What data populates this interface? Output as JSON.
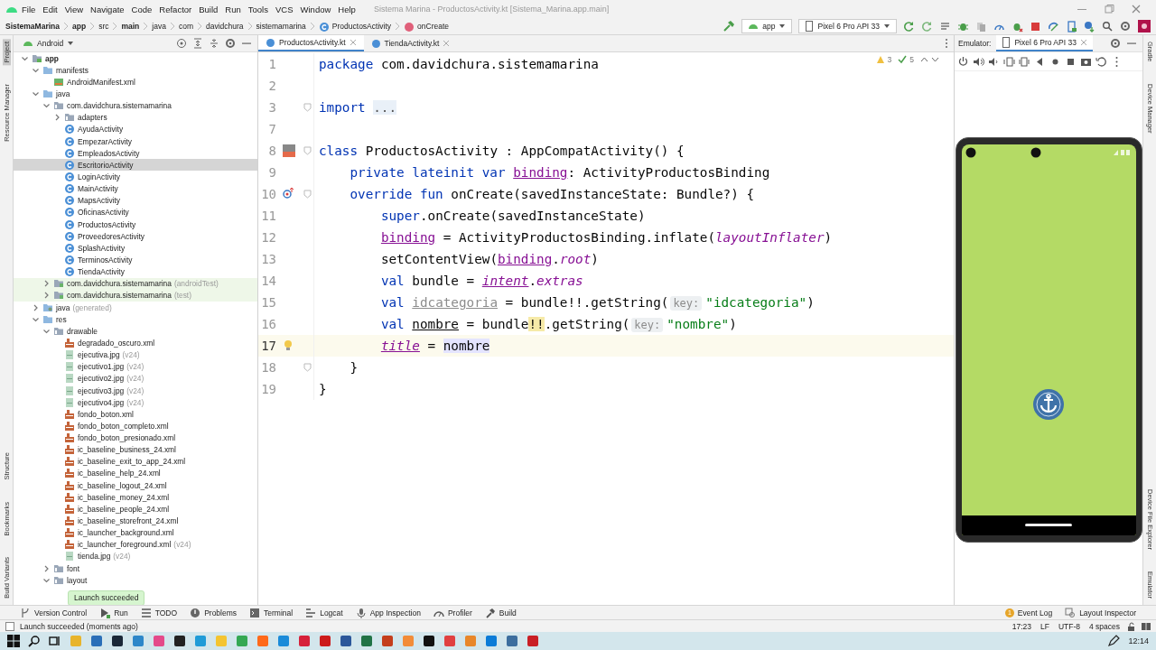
{
  "title_bar": {
    "menu": [
      "File",
      "Edit",
      "View",
      "Navigate",
      "Code",
      "Refactor",
      "Build",
      "Run",
      "Tools",
      "VCS",
      "Window",
      "Help"
    ],
    "title": "Sistema Marina - ProductosActivity.kt [Sistema_Marina.app.main]"
  },
  "breadcrumb": [
    {
      "label": "SistemaMarina",
      "kind": "bold"
    },
    {
      "label": "app",
      "kind": "bold"
    },
    {
      "label": "src",
      "kind": "plain"
    },
    {
      "label": "main",
      "kind": "bold"
    },
    {
      "label": "java",
      "kind": "plain"
    },
    {
      "label": "com",
      "kind": "plain"
    },
    {
      "label": "davidchura",
      "kind": "plain"
    },
    {
      "label": "sistemamarina",
      "kind": "plain"
    },
    {
      "label": "ProductosActivity",
      "kind": "class"
    },
    {
      "label": "onCreate",
      "kind": "method"
    }
  ],
  "toolbar": {
    "config": "app",
    "device": "Pixel 6 Pro API 33"
  },
  "left_tool_tabs": [
    {
      "label": "Project",
      "selected": true,
      "kind": "top"
    },
    {
      "label": "Resource Manager",
      "selected": false,
      "kind": "top"
    },
    {
      "label": "Structure",
      "selected": false,
      "kind": "bottom"
    },
    {
      "label": "Bookmarks",
      "selected": false,
      "kind": "bottom"
    },
    {
      "label": "Build Variants",
      "selected": false,
      "kind": "bottom"
    }
  ],
  "project": {
    "view": "Android",
    "tree": [
      {
        "label": "app",
        "kind": "module",
        "expanded": true,
        "selected": false,
        "children": [
          {
            "label": "manifests",
            "kind": "folder",
            "expanded": true,
            "selected": false,
            "children": [
              {
                "label": "AndroidManifest.xml",
                "kind": "manifest",
                "selected": false
              }
            ]
          },
          {
            "label": "java",
            "kind": "folder",
            "expanded": true,
            "selected": false,
            "children": [
              {
                "label": "com.davidchura.sistemamarina",
                "kind": "package",
                "expanded": true,
                "selected": false,
                "children": [
                  {
                    "label": "adapters",
                    "kind": "package",
                    "expanded": false,
                    "selected": false
                  },
                  {
                    "label": "AyudaActivity",
                    "kind": "class",
                    "selected": false
                  },
                  {
                    "label": "EmpezarActivity",
                    "kind": "class",
                    "selected": false
                  },
                  {
                    "label": "EmpleadosActivity",
                    "kind": "class",
                    "selected": false
                  },
                  {
                    "label": "EscritorioActivity",
                    "kind": "class",
                    "selected": true
                  },
                  {
                    "label": "LoginActivity",
                    "kind": "class",
                    "selected": false
                  },
                  {
                    "label": "MainActivity",
                    "kind": "class",
                    "selected": false
                  },
                  {
                    "label": "MapsActivity",
                    "kind": "class",
                    "selected": false
                  },
                  {
                    "label": "OficinasActivity",
                    "kind": "class",
                    "selected": false
                  },
                  {
                    "label": "ProductosActivity",
                    "kind": "class",
                    "selected": false
                  },
                  {
                    "label": "ProveedoresActivity",
                    "kind": "class",
                    "selected": false
                  },
                  {
                    "label": "SplashActivity",
                    "kind": "class",
                    "selected": false
                  },
                  {
                    "label": "TerminosActivity",
                    "kind": "class",
                    "selected": false
                  },
                  {
                    "label": "TiendaActivity",
                    "kind": "class",
                    "selected": false
                  }
                ]
              },
              {
                "label": "com.davidchura.sistemamarina",
                "note": "(androidTest)",
                "kind": "test_package",
                "expanded": false,
                "selected": false
              },
              {
                "label": "com.davidchura.sistemamarina",
                "note": "(test)",
                "kind": "test_package",
                "expanded": false,
                "selected": false
              }
            ]
          },
          {
            "label": "java",
            "note": "(generated)",
            "kind": "generated",
            "expanded": false,
            "selected": false
          },
          {
            "label": "res",
            "kind": "folder",
            "expanded": true,
            "selected": false,
            "children": [
              {
                "label": "drawable",
                "kind": "package",
                "expanded": true,
                "selected": false,
                "children": [
                  {
                    "label": "degradado_oscuro.xml",
                    "kind": "xml",
                    "selected": false
                  },
                  {
                    "label": "ejecutiva.jpg",
                    "note": "(v24)",
                    "kind": "image",
                    "selected": false
                  },
                  {
                    "label": "ejecutivo1.jpg",
                    "note": "(v24)",
                    "kind": "image",
                    "selected": false
                  },
                  {
                    "label": "ejecutivo2.jpg",
                    "note": "(v24)",
                    "kind": "image",
                    "selected": false
                  },
                  {
                    "label": "ejecutivo3.jpg",
                    "note": "(v24)",
                    "kind": "image",
                    "selected": false
                  },
                  {
                    "label": "ejecutivo4.jpg",
                    "note": "(v24)",
                    "kind": "image",
                    "selected": false
                  },
                  {
                    "label": "fondo_boton.xml",
                    "kind": "xml",
                    "selected": false
                  },
                  {
                    "label": "fondo_boton_completo.xml",
                    "kind": "xml",
                    "selected": false
                  },
                  {
                    "label": "fondo_boton_presionado.xml",
                    "kind": "xml",
                    "selected": false
                  },
                  {
                    "label": "ic_baseline_business_24.xml",
                    "kind": "xml",
                    "selected": false
                  },
                  {
                    "label": "ic_baseline_exit_to_app_24.xml",
                    "kind": "xml",
                    "selected": false
                  },
                  {
                    "label": "ic_baseline_help_24.xml",
                    "kind": "xml",
                    "selected": false
                  },
                  {
                    "label": "ic_baseline_logout_24.xml",
                    "kind": "xml",
                    "selected": false
                  },
                  {
                    "label": "ic_baseline_money_24.xml",
                    "kind": "xml",
                    "selected": false
                  },
                  {
                    "label": "ic_baseline_people_24.xml",
                    "kind": "xml",
                    "selected": false
                  },
                  {
                    "label": "ic_baseline_storefront_24.xml",
                    "kind": "xml",
                    "selected": false
                  },
                  {
                    "label": "ic_launcher_background.xml",
                    "kind": "xml",
                    "selected": false
                  },
                  {
                    "label": "ic_launcher_foreground.xml",
                    "note": "(v24)",
                    "kind": "xml",
                    "selected": false
                  },
                  {
                    "label": "tienda.jpg",
                    "note": "(v24)",
                    "kind": "image",
                    "selected": false
                  }
                ]
              },
              {
                "label": "font",
                "kind": "package",
                "expanded": false,
                "selected": false
              },
              {
                "label": "layout",
                "kind": "package",
                "expanded": true,
                "selected": false
              }
            ]
          }
        ]
      }
    ]
  },
  "toast": "Launch succeeded",
  "editor": {
    "tabs": [
      {
        "label": "ProductosActivity.kt",
        "selected": true
      },
      {
        "label": "TiendaActivity.kt",
        "selected": false
      }
    ],
    "warnings": "3",
    "checks": "5",
    "lines": [
      {
        "number": "1",
        "current": false,
        "tokens": [
          {
            "kw": "package"
          },
          {
            "plain": " com.davidchura.sistemamarina"
          }
        ]
      },
      {
        "number": "2",
        "current": false
      },
      {
        "number": "3",
        "current": false,
        "fold": true,
        "tokens": [
          {
            "kw": "import "
          },
          {
            "folded": "..."
          }
        ]
      },
      {
        "number": "7",
        "current": false
      },
      {
        "number": "8",
        "current": false,
        "gutter": {
          "kind": "layout"
        },
        "fold": true,
        "tokens": [
          {
            "kw": "class"
          },
          {
            "plain": " ProductosActivity : AppCompatActivity() {"
          }
        ]
      },
      {
        "number": "9",
        "current": false,
        "tokens": [
          {
            "kw": "    private lateinit var "
          },
          {
            "prop_u": "binding"
          },
          {
            "plain": ": ActivityProductosBinding"
          }
        ]
      },
      {
        "number": "10",
        "current": false,
        "gutter": {
          "kind": "override"
        },
        "fold": true,
        "tokens": [
          {
            "kw": "    override fun"
          },
          {
            "plain": " onCreate(savedInstanceState: Bundle?) {"
          }
        ]
      },
      {
        "number": "11",
        "current": false,
        "tokens": [
          {
            "kw": "        super"
          },
          {
            "plain": ".onCreate(savedInstanceState)"
          }
        ]
      },
      {
        "number": "12",
        "current": false,
        "tokens": [
          {
            "prop_u": "        binding"
          },
          {
            "plain": " = ActivityProductosBinding.inflate("
          },
          {
            "ext": "layoutInflater"
          },
          {
            "plain": ")"
          }
        ]
      },
      {
        "number": "13",
        "current": false,
        "tokens": [
          {
            "plain": "        setContentView("
          },
          {
            "prop_u": "binding"
          },
          {
            "plain": "."
          },
          {
            "ext": "root"
          },
          {
            "plain": ")"
          }
        ]
      },
      {
        "number": "14",
        "current": false,
        "tokens": [
          {
            "kw": "        val"
          },
          {
            "plain": " bundle = "
          },
          {
            "ext_u": "intent"
          },
          {
            "plain": "."
          },
          {
            "ext": "extras"
          }
        ]
      },
      {
        "number": "15",
        "current": false,
        "tokens": [
          {
            "kw": "        val "
          },
          {
            "unused": "idcategoria"
          },
          {
            "plain": " = bundle!!.getString("
          },
          {
            "hint": "key:"
          },
          {
            "string": "\"idcategoria\""
          },
          {
            "plain": ")"
          }
        ]
      },
      {
        "number": "16",
        "current": false,
        "tokens": [
          {
            "kw": "        val "
          },
          {
            "local_u": "nombre"
          },
          {
            "plain": " = bundle"
          },
          {
            "warn": "!!"
          },
          {
            "plain": ".getString("
          },
          {
            "hint": "key:"
          },
          {
            "string": "\"nombre\""
          },
          {
            "plain": ")"
          }
        ]
      },
      {
        "number": "17",
        "current": true,
        "gutter": {
          "kind": "bulb"
        },
        "tokens": [
          {
            "ext_u": "        title"
          },
          {
            "plain": " = "
          },
          {
            "usage": "nombre"
          }
        ]
      },
      {
        "number": "18",
        "current": false,
        "fold": true,
        "tokens": [
          {
            "plain": "    }"
          }
        ]
      },
      {
        "number": "19",
        "current": false,
        "tokens": [
          {
            "plain": "}"
          }
        ]
      }
    ]
  },
  "emulator": {
    "label": "Emulator:",
    "tab": "Pixel 6 Pro API 33"
  },
  "right_tool_tabs": [
    {
      "label": "Gradle",
      "kind": "top"
    },
    {
      "label": "Device Manager",
      "kind": "top"
    },
    {
      "label": "Device File Explorer",
      "kind": "bottom"
    },
    {
      "label": "Emulator",
      "kind": "bottom"
    }
  ],
  "tool_windows": [
    "Version Control",
    "Run",
    "TODO",
    "Problems",
    "Terminal",
    "Logcat",
    "App Inspection",
    "Profiler",
    "Build"
  ],
  "right_tools": {
    "event_count": "1",
    "event_log": "Event Log",
    "layout_inspector": "Layout Inspector"
  },
  "status_bar": {
    "message": "Launch succeeded (moments ago)",
    "position": "17:23",
    "line_separator": "LF",
    "encoding": "UTF-8",
    "indent": "4 spaces"
  },
  "taskbar": {
    "clock": "12:14"
  }
}
